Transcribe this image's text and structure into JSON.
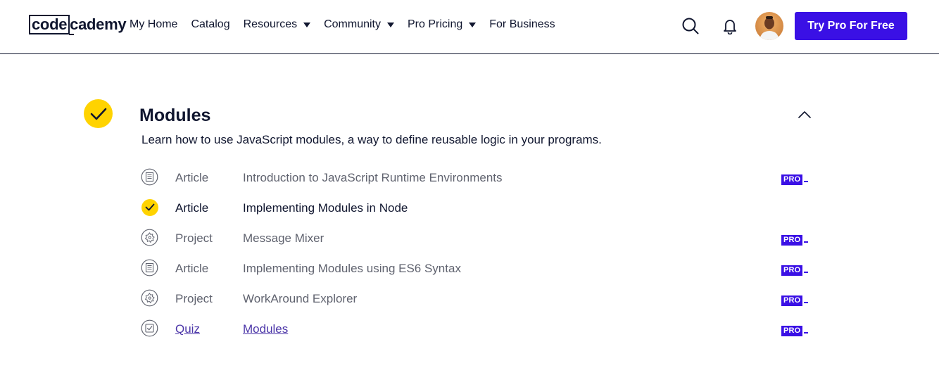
{
  "header": {
    "logo_left": "code",
    "logo_right": "cademy",
    "nav": [
      {
        "label": "My Home",
        "dropdown": false
      },
      {
        "label": "Catalog",
        "dropdown": false
      },
      {
        "label": "Resources",
        "dropdown": true
      },
      {
        "label": "Community",
        "dropdown": true
      },
      {
        "label": "Pro Pricing",
        "dropdown": true
      },
      {
        "label": "For Business",
        "dropdown": false
      }
    ],
    "cta_label": "Try Pro For Free",
    "icons": {
      "search": "search-icon",
      "notifications": "bell-icon",
      "avatar": "avatar"
    }
  },
  "module": {
    "title": "Modules",
    "description": "Learn how to use JavaScript modules, a way to define reusable logic in your programs.",
    "completed": true,
    "items": [
      {
        "type": "Article",
        "name": "Introduction to JavaScript Runtime Environments",
        "icon": "article-icon",
        "pro": "PRO",
        "completed": false
      },
      {
        "type": "Article",
        "name": "Implementing Modules in Node",
        "icon": "check-icon",
        "pro": "",
        "completed": true
      },
      {
        "type": "Project",
        "name": "Message Mixer",
        "icon": "project-icon",
        "pro": "PRO",
        "completed": false
      },
      {
        "type": "Article",
        "name": "Implementing Modules using ES6 Syntax",
        "icon": "article-icon",
        "pro": "PRO",
        "completed": false
      },
      {
        "type": "Project",
        "name": "WorkAround Explorer",
        "icon": "project-icon",
        "pro": "PRO",
        "completed": false
      },
      {
        "type": "Quiz",
        "name": "Modules",
        "icon": "quiz-icon",
        "pro": "PRO",
        "completed": false
      }
    ]
  },
  "colors": {
    "brand": "#3a10e5",
    "check": "#ffd300",
    "ink": "#10162f",
    "muted": "#60636f"
  }
}
